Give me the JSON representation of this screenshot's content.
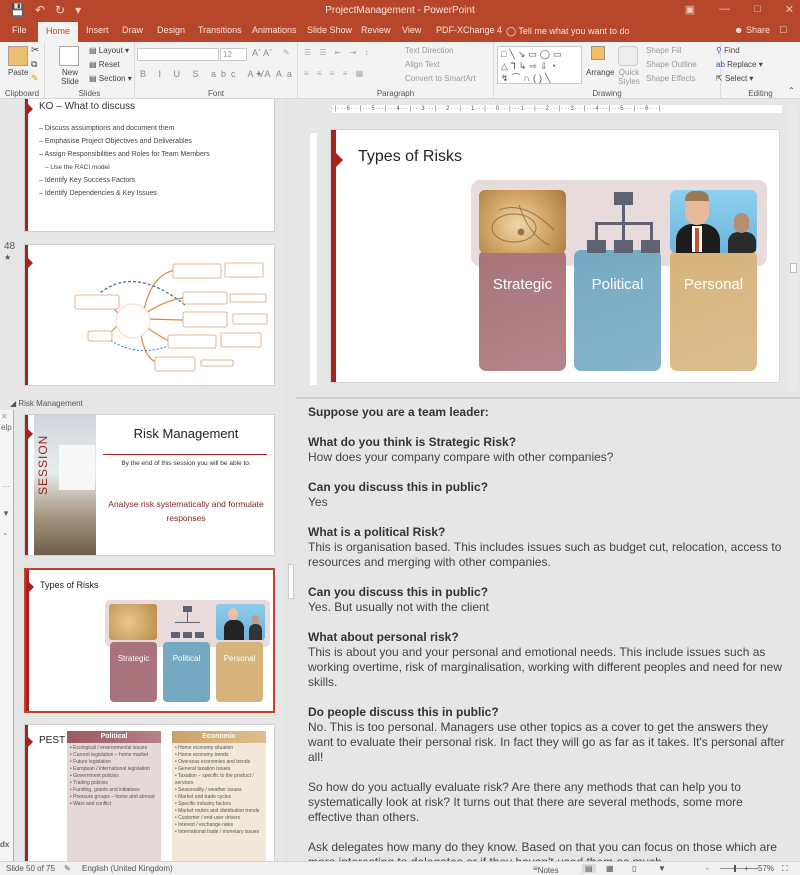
{
  "window": {
    "title": "ProjectManagement - PowerPoint",
    "qat": [
      "save-icon",
      "undo-icon",
      "redo-icon",
      "customize-icon"
    ]
  },
  "tabs": [
    {
      "label": "File"
    },
    {
      "label": "Home",
      "active": true
    },
    {
      "label": "Insert"
    },
    {
      "label": "Draw"
    },
    {
      "label": "Design"
    },
    {
      "label": "Transitions"
    },
    {
      "label": "Animations"
    },
    {
      "label": "Slide Show"
    },
    {
      "label": "Review"
    },
    {
      "label": "View"
    },
    {
      "label": "PDF-XChange 4"
    }
  ],
  "tellme": "Tell me what you want to do",
  "share": "Share",
  "ribbon": {
    "clipboard": {
      "label": "Clipboard",
      "paste": "Paste"
    },
    "slides": {
      "label": "Slides",
      "new_slide": "New Slide",
      "layout": "Layout",
      "reset": "Reset",
      "section": "Section"
    },
    "font": {
      "label": "Font",
      "font_name": "",
      "font_size": "12"
    },
    "paragraph": {
      "label": "Paragraph",
      "text_direction": "Text Direction",
      "align_text": "Align Text",
      "convert_smartart": "Convert to SmartArt"
    },
    "drawing": {
      "label": "Drawing",
      "arrange": "Arrange",
      "quick_styles": "Quick Styles",
      "shape_fill": "Shape Fill",
      "shape_outline": "Shape Outline",
      "shape_effects": "Shape Effects"
    },
    "editing": {
      "label": "Editing",
      "find": "Find",
      "replace": "Replace",
      "select": "Select"
    }
  },
  "thumbnails": {
    "slide47": {
      "title": "KO – What to discuss",
      "bullets": [
        "– Discuss assumptions and document them",
        "– Emphasise Project Objectives and Deliverables",
        "– Assign Responsibilities and Roles for Team Members",
        "– Use the RACI model",
        "– Identify Key Success Factors",
        "– Identify Dependencies & Key Issues"
      ]
    },
    "slide48": {
      "number": "48",
      "star": "★",
      "content": "mind-map diagram"
    },
    "section": "Risk Management",
    "slide49": {
      "title": "Risk Management",
      "side_label": "SESSION",
      "subtitle": "By the end of this session you will be able to:",
      "objective": "Analyse risk systematically and formulate responses"
    },
    "slide50": {
      "title": "Types of Risks",
      "cards": [
        "Strategic",
        "Political",
        "Personal"
      ]
    },
    "slide51": {
      "title": "PEST",
      "political": {
        "header": "Political",
        "items": [
          "Ecological / environmental issues",
          "Current legislation – home market",
          "Future legislation",
          "European / international legislation",
          "Government policies",
          "Trading policies",
          "Funding, grants and initiatives",
          "Pressure groups – home and abroad",
          "Wars and conflict"
        ]
      },
      "economic": {
        "header": "Economic",
        "items": [
          "Home economy situation",
          "Home economy trends",
          "Overseas economies and trends",
          "General taxation issues",
          "Taxation – specific to the product / services",
          "Seasonality / weather issues",
          "Market and trade cycles",
          "Specific industry factors",
          "Market routes and distribution trends",
          "Customer / end-user drivers",
          "Interest / exchange rates",
          "International trade / monetary issues"
        ]
      }
    }
  },
  "overlay": {
    "help": "elp",
    "file": "dx"
  },
  "slide": {
    "title": "Types of Risks",
    "cards": [
      {
        "label": "Strategic",
        "color": "#a8737a"
      },
      {
        "label": "Political",
        "color": "#75a9c2"
      },
      {
        "label": "Personal",
        "color": "#d6b47c"
      }
    ],
    "ruler_text": "·|···6···|···5···|···4···|···3···|···2···|···1···|···0···|···1···|···2···|···3···|···4···|···5···|···6···|·"
  },
  "notes": {
    "intro": "Suppose you are a team leader:",
    "qa": [
      {
        "q": "What do you think is Strategic Risk?",
        "a": "How does your company compare with other companies?"
      },
      {
        "q": "Can you discuss this in public?",
        "a": "Yes"
      },
      {
        "q": "What is a political Risk?",
        "a": "This is organisation based. This includes issues such as budget cut, relocation, access to resources and merging with other companies."
      },
      {
        "q": "Can you discuss this in public?",
        "a": "Yes. But usually not with the client"
      },
      {
        "q": "What about personal risk?",
        "a": "This is about you and your personal and emotional needs. This include issues such as working overtime, risk of marginalisation, working with different peoples and need for new skills."
      },
      {
        "q": "Do people discuss this in public?",
        "a": "No. This is too personal. Managers use other topics as a cover to get the answers they want to evaluate their personal risk. In fact they will go as far as it takes. It's personal after all!"
      }
    ],
    "para1": "So how do you actually evaluate risk? Are there any methods that can help you to systematically look at risk? It turns out that there are several methods, some more effective than others.",
    "para2": "Ask delegates how many do they know. Based on that you can focus on those which are more interesting to delegates or if they haven't used them as much."
  },
  "status": {
    "slide_info": "Slide 50 of 75",
    "language": "English (United Kingdom)",
    "notes": "Notes",
    "zoom": "57%",
    "zoom_fraction": 0.57
  }
}
